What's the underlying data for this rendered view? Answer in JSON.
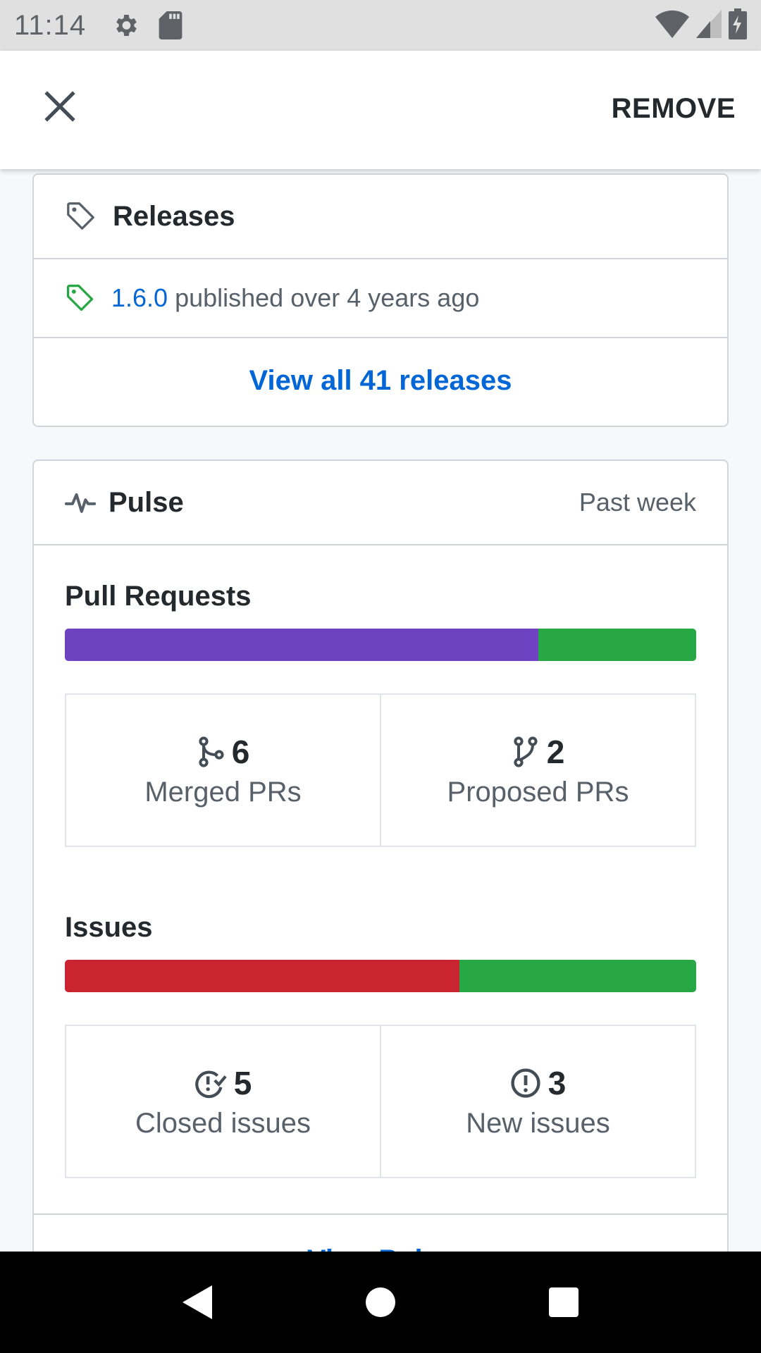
{
  "status_bar": {
    "time": "11:14",
    "icons": [
      "gear-icon",
      "sd-card-icon",
      "wifi-icon",
      "signal-icon",
      "battery-charging-icon"
    ]
  },
  "app_bar": {
    "close_icon": "close-icon",
    "remove_label": "REMOVE"
  },
  "releases": {
    "title": "Releases",
    "icon": "tag-icon",
    "latest": {
      "version": "1.6.0",
      "text": "published over 4 years ago",
      "icon": "tag-icon"
    },
    "view_all_label": "View all 41 releases"
  },
  "pulse": {
    "title": "Pulse",
    "icon": "pulse-icon",
    "period": "Past week",
    "pull_requests": {
      "title": "Pull Requests",
      "merged": {
        "count": "6",
        "label": "Merged PRs",
        "icon": "git-merge-icon"
      },
      "proposed": {
        "count": "2",
        "label": "Proposed PRs",
        "icon": "git-pull-request-icon"
      },
      "bar": {
        "merged_fraction": 0.75,
        "merged_color": "#6f42c1",
        "proposed_color": "#28a745"
      }
    },
    "issues": {
      "title": "Issues",
      "closed": {
        "count": "5",
        "label": "Closed issues",
        "icon": "issue-closed-icon"
      },
      "new": {
        "count": "3",
        "label": "New issues",
        "icon": "issue-opened-icon"
      },
      "bar": {
        "closed_fraction": 0.625,
        "closed_color": "#cb2431",
        "new_color": "#28a745"
      }
    },
    "view_pulse_label": "View Pulse"
  },
  "nav_bar": {
    "icons": [
      "back-icon",
      "home-icon",
      "recents-icon"
    ]
  }
}
